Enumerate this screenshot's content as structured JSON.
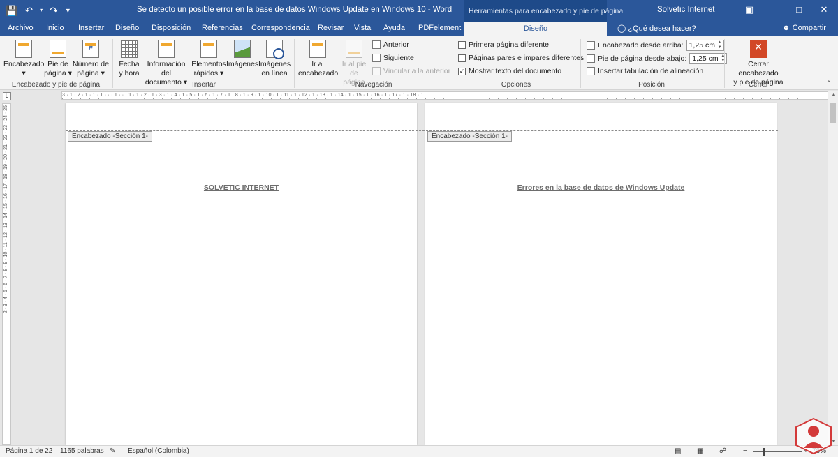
{
  "window": {
    "title": "Se detecto un posible error en la base de datos Windows Update en Windows 10  -  Word",
    "context_title": "Herramientas para encabezado y pie de página",
    "user": "Solvetic Internet"
  },
  "qat": {
    "save": "save-icon",
    "undo": "undo-icon",
    "redo": "redo-icon",
    "customize": "customize-qat-icon"
  },
  "tabs": [
    "Archivo",
    "Inicio",
    "Insertar",
    "Diseño",
    "Disposición",
    "Referencias",
    "Correspondencia",
    "Revisar",
    "Vista",
    "Ayuda",
    "PDFelement"
  ],
  "active_tab": "Diseño",
  "tell_me": "¿Qué desea hacer?",
  "share": "Compartir",
  "ribbon": {
    "group1": {
      "label": "Encabezado y pie de página",
      "encabezado": [
        "Encabezado",
        "▾"
      ],
      "pie": [
        "Pie de",
        "página ▾"
      ],
      "numero": [
        "Número de",
        "página ▾"
      ]
    },
    "group2": {
      "label": "Insertar",
      "fecha": [
        "Fecha",
        "y hora"
      ],
      "info": [
        "Información del",
        "documento ▾"
      ],
      "elementos": [
        "Elementos",
        "rápidos ▾"
      ],
      "imagenes": [
        "Imágenes",
        ""
      ],
      "imagenes_linea": [
        "Imágenes",
        "en línea"
      ],
      "num_icon_glyph": "#"
    },
    "group3": {
      "label": "Navegación",
      "ir_encabezado": [
        "Ir al",
        "encabezado"
      ],
      "ir_pie": [
        "Ir al pie",
        "de página"
      ],
      "anterior": "Anterior",
      "siguiente": "Siguiente",
      "vincular": "Vincular a la anterior"
    },
    "group4": {
      "label": "Opciones",
      "primera": "Primera página diferente",
      "pares": "Páginas pares e impares diferentes",
      "mostrar": "Mostrar texto del documento",
      "mostrar_checked": "✓"
    },
    "group5": {
      "label": "Posición",
      "enc_arriba": "Encabezado desde arriba:",
      "enc_arriba_val": "1,25 cm",
      "pie_abajo": "Pie de página desde abajo:",
      "pie_abajo_val": "1,25 cm",
      "tabulacion": "Insertar tabulación de alineación"
    },
    "group6": {
      "label": "Cerrar",
      "cerrar": [
        "Cerrar encabezado",
        "y pie de página"
      ],
      "cerrar_glyph": "✕"
    }
  },
  "ruler": {
    "corner": "L",
    "h_numbers": "3 · 1 · 2 · 1 · 1 · 1 · · · 1 · · · 1 · 1 · 2 · 1 · 3 · 1 · 4 · 1 · 5 · 1 · 6 · 1 · 7 · 1 · 8 · 1 · 9 · 1 · 10 · 1 · 11 · 1 · 12 · 1 · 13 · 1 · 14 · 1 · 15 · 1 · 16 · 1 · 17 · 1 · 18 · 1",
    "v_numbers": "2 · 3 · 4 · 5 · 6 · 7 · 8 · 9 · 10 · 11 · 12 · 13 · 14 · 15 · 16 · 17 · 18 · 19 · 20 · 21 · 22 · 23 · 24 · 25"
  },
  "pages": [
    {
      "section_tag": "Encabezado -Sección 1-",
      "header_text": "SOLVETIC INTERNET"
    },
    {
      "section_tag": "Encabezado -Sección 1-",
      "header_text": "Errores en la base de datos de Windows Update"
    }
  ],
  "status": {
    "page": "Página 1 de 22",
    "words": "1165 palabras",
    "language": "Español (Colombia)",
    "zoom_minus": "−",
    "zoom_plus": "+",
    "zoom": "78%"
  },
  "watermark": {
    "text": "S"
  },
  "colors": {
    "brand": "#2b579a",
    "context": "#1e4a89",
    "close_accent": "#d24726",
    "header_text": "#6d6d6d"
  }
}
